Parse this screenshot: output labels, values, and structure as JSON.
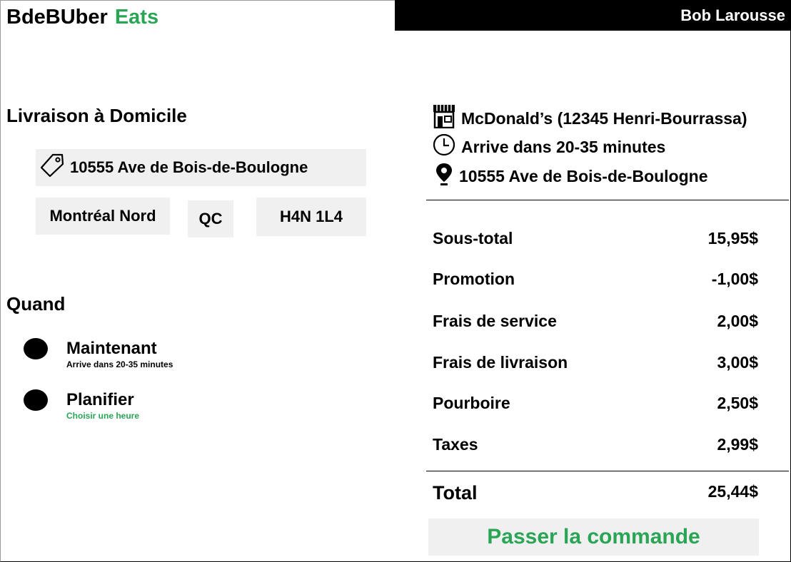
{
  "brand": {
    "name": "BdeBUber",
    "suffix": "Eats",
    "accent_color": "#2aa556"
  },
  "header": {
    "user_name": "Bob Larousse"
  },
  "delivery": {
    "title": "Livraison à Domicile",
    "address_icon": "tag-icon",
    "address": "10555 Ave de Bois-de-Boulogne",
    "city": "Montréal Nord",
    "province": "QC",
    "postal_code": "H4N 1L4"
  },
  "when": {
    "title": "Quand",
    "options": [
      {
        "label": "Maintenant",
        "sublabel": "Arrive dans 20-35 minutes"
      },
      {
        "label": "Planifier",
        "sublabel": "Choisir une heure"
      }
    ]
  },
  "order_info": {
    "restaurant": "McDonald’s (12345 Henri-Bourrassa)",
    "restaurant_icon": "store-icon",
    "eta": "Arrive dans 20-35 minutes",
    "eta_icon": "clock-icon",
    "address": "10555 Ave de Bois-de-Boulogne",
    "address_icon": "location-pin-icon"
  },
  "summary": {
    "rows": [
      {
        "label": "Sous-total",
        "value": "15,95$"
      },
      {
        "label": "Promotion",
        "value": "-1,00$"
      },
      {
        "label": "Frais de service",
        "value": "2,00$"
      },
      {
        "label": "Frais de livraison",
        "value": "3,00$"
      },
      {
        "label": "Pourboire",
        "value": "2,50$"
      },
      {
        "label": "Taxes",
        "value": "2,99$"
      }
    ],
    "total_label": "Total",
    "total_value": "25,44$"
  },
  "checkout": {
    "button_label": "Passer la commande"
  }
}
